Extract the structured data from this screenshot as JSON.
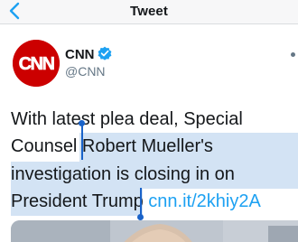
{
  "nav": {
    "title": "Tweet",
    "back_icon": "chevron-left-icon",
    "accent": "#1da1f2"
  },
  "author": {
    "name": "CNN",
    "handle": "@CNN",
    "avatar_text": "CNN",
    "avatar_color": "#cc0000",
    "verified": true
  },
  "tweet": {
    "lines": [
      "With latest plea deal, Special",
      "Counsel Robert Mueller's",
      "investigation is closing in on",
      "President Trump"
    ],
    "link": "cnn.it/2khiy2A",
    "selection_color": "#d3e3f4",
    "caret_color": "#1a63c9"
  }
}
